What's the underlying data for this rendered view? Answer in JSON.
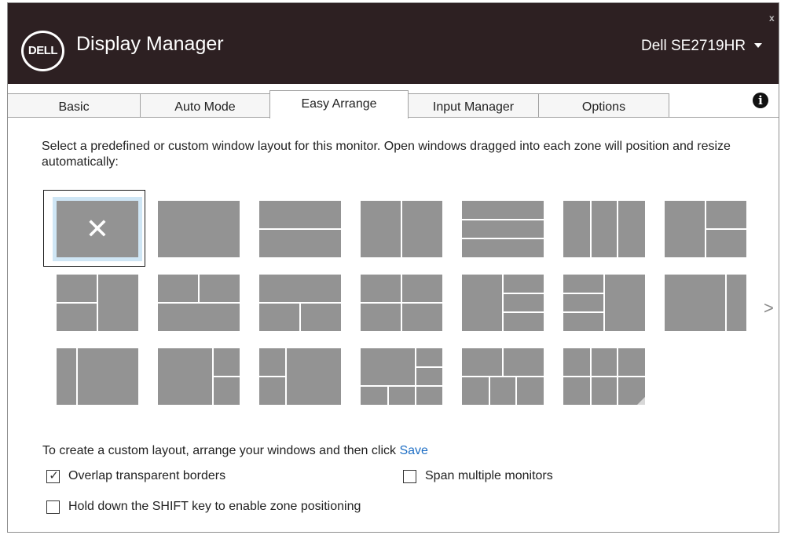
{
  "app": {
    "logo_text": "DELL",
    "title": "Display Manager",
    "monitor": "Dell SE2719HR",
    "close_glyph": "x"
  },
  "tabs": [
    {
      "label": "Basic",
      "active": false
    },
    {
      "label": "Auto Mode",
      "active": false
    },
    {
      "label": "Easy Arrange",
      "active": true
    },
    {
      "label": "Input Manager",
      "active": false
    },
    {
      "label": "Options",
      "active": false
    }
  ],
  "icons": {
    "info": "info-icon",
    "deselect": "x-icon",
    "next": "chevron-right-icon",
    "custom_grip": "resize-grip-icon"
  },
  "easy_arrange": {
    "description": "Select a predefined or custom window layout for this monitor.  Open windows dragged into each zone will position and resize automatically:",
    "next_glyph": ">",
    "layouts": [
      "none",
      "single",
      "two-horizontal",
      "two-vertical",
      "three-horizontal",
      "three-vertical",
      "left-plus-right-split",
      "left-split-plus-right",
      "top-split-bottom-full",
      "top-full-bottom-split",
      "four-grid",
      "left-plus-right-three",
      "left-three-plus-right",
      "right-narrow",
      "left-narrow",
      "left-wide-right-split",
      "left-split-right-wide",
      "left-wide-right-split-bottom-three",
      "top-two-bottom-three",
      "custom-six-grid"
    ],
    "selected_layout": "none",
    "custom_prefix": "To create a custom layout, arrange your windows and then click ",
    "save_label": "Save",
    "options": {
      "overlap_label": "Overlap transparent borders",
      "overlap_checked": true,
      "span_label": "Span multiple monitors",
      "span_checked": false,
      "shift_label": "Hold down the SHIFT key to enable zone positioning",
      "shift_checked": false
    }
  },
  "colors": {
    "titlebar": "#2d2022",
    "tile": "#939393",
    "selection": "#cfe6f5",
    "link": "#1f6fc5"
  }
}
